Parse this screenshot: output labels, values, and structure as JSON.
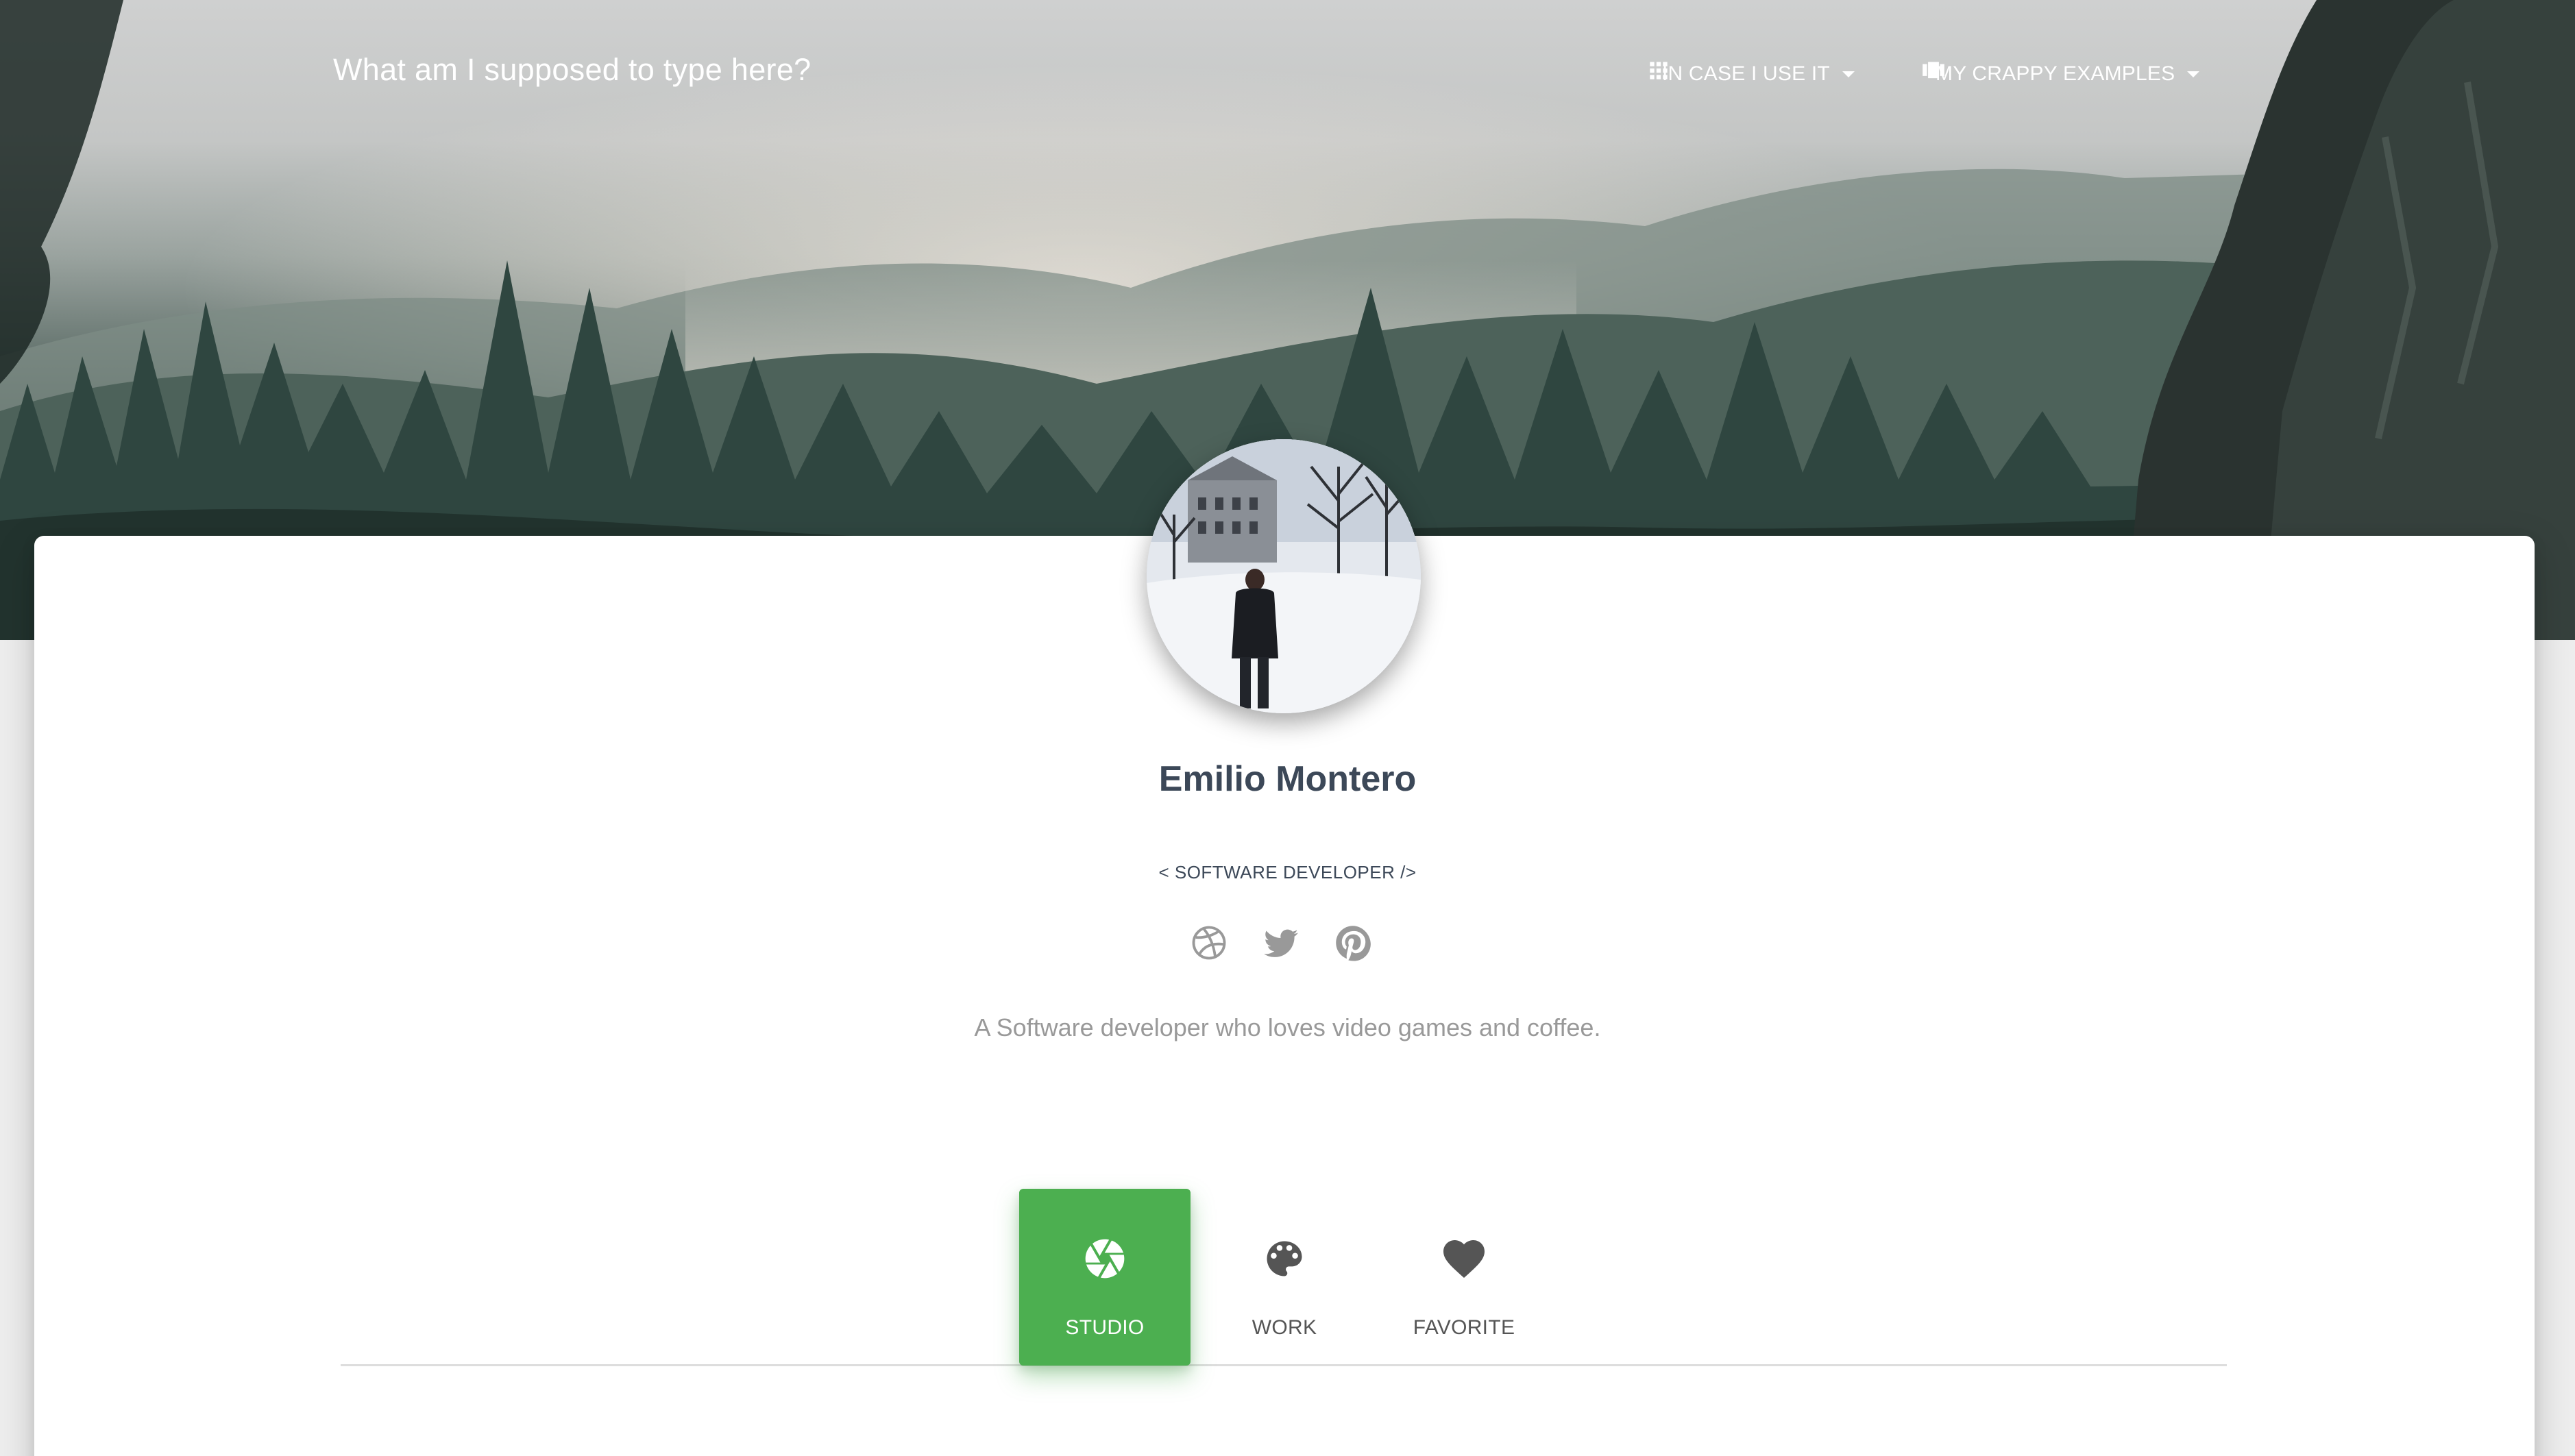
{
  "navbar": {
    "brand": "What am I supposed to type here?",
    "items": [
      {
        "label": "IN CASE I USE IT",
        "icon": "apps-grid-icon"
      },
      {
        "label": "MY CRAPPY EXAMPLES",
        "icon": "view-carousel-icon"
      }
    ]
  },
  "profile": {
    "avatar_icon": "profile-photo",
    "name": "Emilio Montero",
    "title": "< SOFTWARE DEVELOPER />",
    "bio": "A Software developer who loves video games and coffee.",
    "socials": [
      {
        "icon": "dribbble-icon"
      },
      {
        "icon": "twitter-icon"
      },
      {
        "icon": "pinterest-icon"
      }
    ]
  },
  "tabs": [
    {
      "label": "STUDIO",
      "icon": "camera-aperture-icon",
      "active": true
    },
    {
      "label": "WORK",
      "icon": "palette-icon",
      "active": false
    },
    {
      "label": "FAVORITE",
      "icon": "heart-icon",
      "active": false
    }
  ],
  "colors": {
    "accent": "#4caf50",
    "heading": "#3c4858",
    "muted": "#999999",
    "icon": "#555555"
  }
}
